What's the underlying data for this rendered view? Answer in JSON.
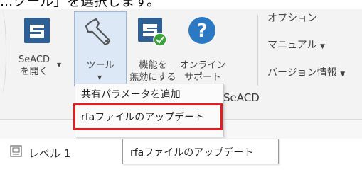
{
  "caption": "...ツール」を選択します。",
  "ribbon": {
    "seacd_open_label_1": "SeACD",
    "seacd_open_label_2": "を開く",
    "tool_label": "ツール",
    "disable_label_1": "機能を",
    "disable_label_2": "無効にする",
    "online_label_1": "オンライン",
    "online_label_2": "サポート",
    "menu_options": "オプション",
    "menu_manual": "マニュアル",
    "menu_version": "バージョン情報",
    "group_label": "SeACD"
  },
  "dropdown": {
    "items": [
      "共有パラメータを追加",
      "rfaファイルのアップデート"
    ]
  },
  "status": {
    "level_tab": "レベル 1"
  },
  "tooltip": {
    "text": "rfaファイルのアップデート"
  },
  "colors": {
    "highlight": "#e02020",
    "seacd_blue": "#2e5f95",
    "help_blue": "#2b79c2",
    "check_green": "#3aa33a"
  }
}
